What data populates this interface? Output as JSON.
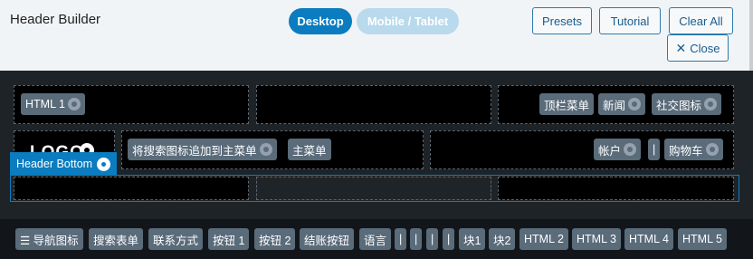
{
  "header": {
    "title": "Header Builder",
    "tabs": {
      "desktop": "Desktop",
      "mobile": "Mobile / Tablet"
    },
    "buttons": {
      "presets": "Presets",
      "tutorial": "Tutorial",
      "clear_all": "Clear All",
      "close": "Close",
      "close_icon": "✕"
    }
  },
  "rows": {
    "top": {
      "left": [
        "HTML 1"
      ],
      "right": [
        "顶栏菜单",
        "新闻",
        "社交图标"
      ]
    },
    "main": {
      "logo": "LOGO",
      "center": [
        "将搜索图标追加到主菜单",
        "主菜单"
      ],
      "right": [
        "帐户",
        "|",
        "购物车"
      ]
    },
    "bottom": {
      "label": "Header Bottom"
    }
  },
  "palette": {
    "items": [
      "☰ 导航图标",
      "搜索表单",
      "联系方式",
      "按钮 1",
      "按钮 2",
      "结账按钮",
      "语言",
      "|",
      "|",
      "|",
      "|",
      "块1",
      "块2",
      "HTML 2",
      "HTML 3",
      "HTML 4",
      "HTML 5"
    ]
  },
  "colors": {
    "accent": "#0a7cbf",
    "builder_bg": "#1d2327",
    "chip_bg": "#5a6b7a"
  }
}
